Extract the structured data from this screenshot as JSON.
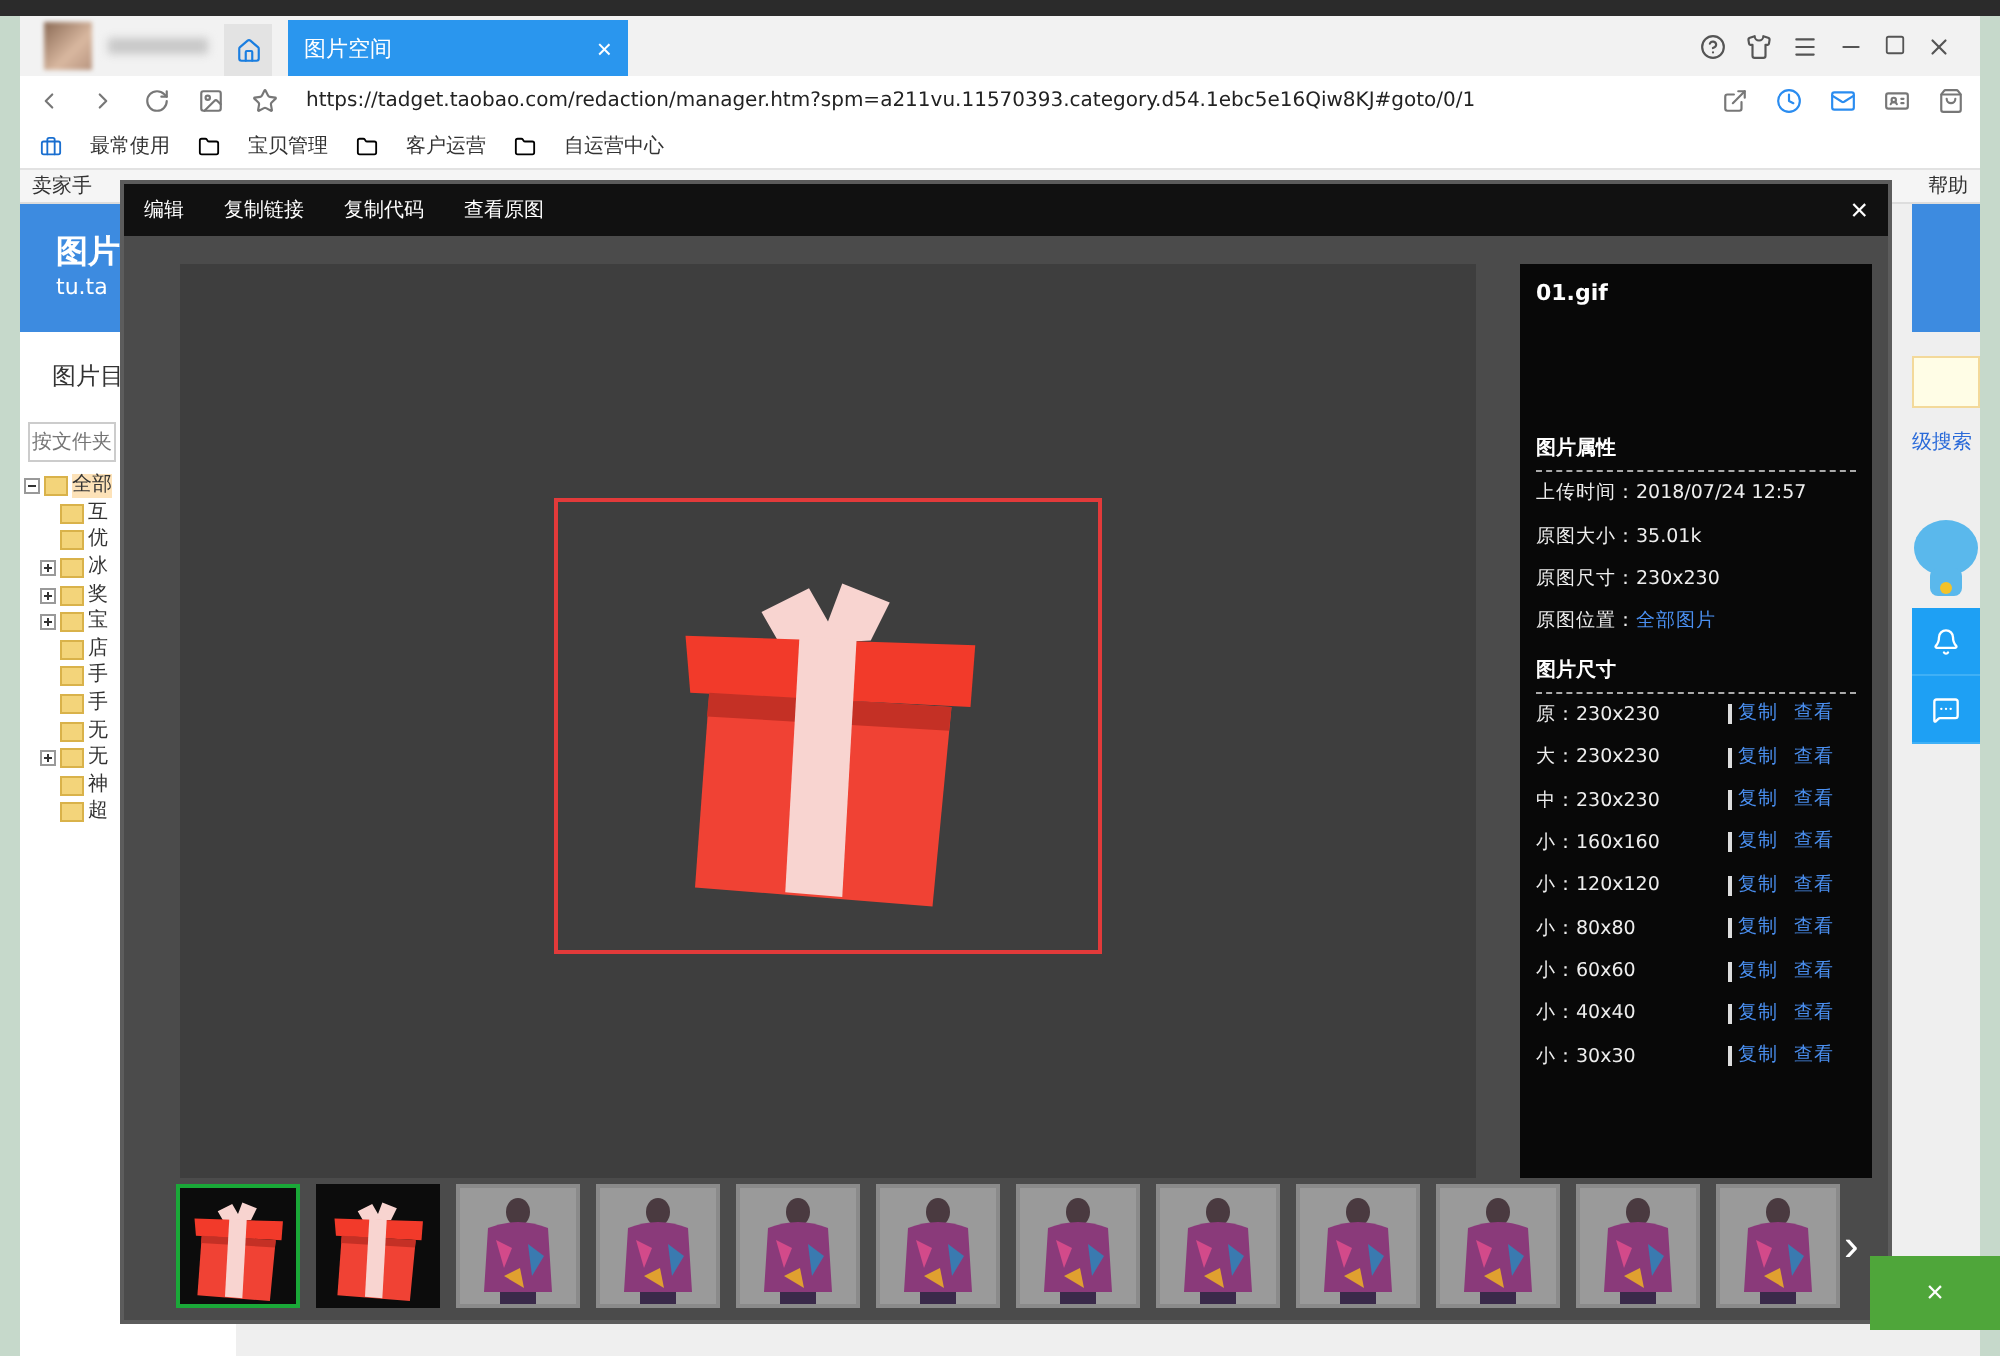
{
  "browser": {
    "tab": {
      "title": "图片空间",
      "close": "×"
    },
    "url": "https://tadget.taobao.com/redaction/manager.htm?spm=a211vu.11570393.category.d54.1ebc5e16Qiw8KJ#goto/0/1",
    "bookmarks": [
      {
        "label": "最常使用",
        "kind": "box"
      },
      {
        "label": "宝贝管理",
        "kind": "folder"
      },
      {
        "label": "客户运营",
        "kind": "folder"
      },
      {
        "label": "自运营中心",
        "kind": "folder"
      }
    ]
  },
  "page": {
    "top_left": "卖家手",
    "help": "帮助",
    "logo": "图片",
    "logo_sub": "tu.ta",
    "directory": "图片目",
    "search_placeholder": "按文件夹",
    "advanced_search": "级搜索",
    "tree": {
      "label": "全部",
      "expanded": true,
      "selected": true,
      "children": [
        {
          "label": "互",
          "collapsed": false,
          "selected": false
        },
        {
          "label": "优",
          "collapsed": false,
          "selected": false
        },
        {
          "label": "冰",
          "collapsed": true,
          "selected": false
        },
        {
          "label": "奖",
          "collapsed": true,
          "selected": false
        },
        {
          "label": "宝",
          "collapsed": true,
          "selected": false
        },
        {
          "label": "店",
          "collapsed": false,
          "selected": false
        },
        {
          "label": "手",
          "collapsed": false,
          "selected": false
        },
        {
          "label": "手",
          "collapsed": false,
          "selected": false
        },
        {
          "label": "无",
          "collapsed": false,
          "selected": false
        },
        {
          "label": "无",
          "collapsed": true,
          "selected": false
        },
        {
          "label": "神",
          "collapsed": false,
          "selected": false
        },
        {
          "label": "超",
          "collapsed": false,
          "selected": false
        }
      ]
    }
  },
  "viewer": {
    "toolbar": [
      "编辑",
      "复制链接",
      "复制代码",
      "查看原图"
    ],
    "close": "×",
    "info": {
      "filename": "01.gif",
      "props_title": "图片属性",
      "props": [
        {
          "label": "上传时间：",
          "value": "2018/07/24 12:57",
          "kind": "text"
        },
        {
          "label": "原图大小：",
          "value": "35.01k",
          "kind": "text"
        },
        {
          "label": "原图尺寸：",
          "value": "230x230",
          "kind": "text"
        },
        {
          "label": "原图位置：",
          "value": "全部图片",
          "kind": "link"
        }
      ],
      "sizes_title": "图片尺寸",
      "sizes": [
        {
          "label": "原：",
          "value": "230x230",
          "copy": "复制",
          "view": "查看"
        },
        {
          "label": "大：",
          "value": "230x230",
          "copy": "复制",
          "view": "查看"
        },
        {
          "label": "中：",
          "value": "230x230",
          "copy": "复制",
          "view": "查看"
        },
        {
          "label": "小：",
          "value": "160x160",
          "copy": "复制",
          "view": "查看"
        },
        {
          "label": "小：",
          "value": "120x120",
          "copy": "复制",
          "view": "查看"
        },
        {
          "label": "小：",
          "value": "80x80",
          "copy": "复制",
          "view": "查看"
        },
        {
          "label": "小：",
          "value": "60x60",
          "copy": "复制",
          "view": "查看"
        },
        {
          "label": "小：",
          "value": "40x40",
          "copy": "复制",
          "view": "查看"
        },
        {
          "label": "小：",
          "value": "30x30",
          "copy": "复制",
          "view": "查看"
        }
      ]
    },
    "thumbnails": [
      {
        "kind": "gift",
        "selected": true
      },
      {
        "kind": "gift",
        "selected": false
      },
      {
        "kind": "picture",
        "selected": false
      },
      {
        "kind": "picture",
        "selected": false
      },
      {
        "kind": "picture",
        "selected": false
      },
      {
        "kind": "picture",
        "selected": false
      },
      {
        "kind": "picture",
        "selected": false
      },
      {
        "kind": "picture",
        "selected": false
      },
      {
        "kind": "picture",
        "selected": false
      },
      {
        "kind": "picture",
        "selected": false
      },
      {
        "kind": "picture",
        "selected": false
      },
      {
        "kind": "picture",
        "selected": false
      }
    ],
    "next": "›"
  },
  "notice": {
    "close": "×"
  }
}
